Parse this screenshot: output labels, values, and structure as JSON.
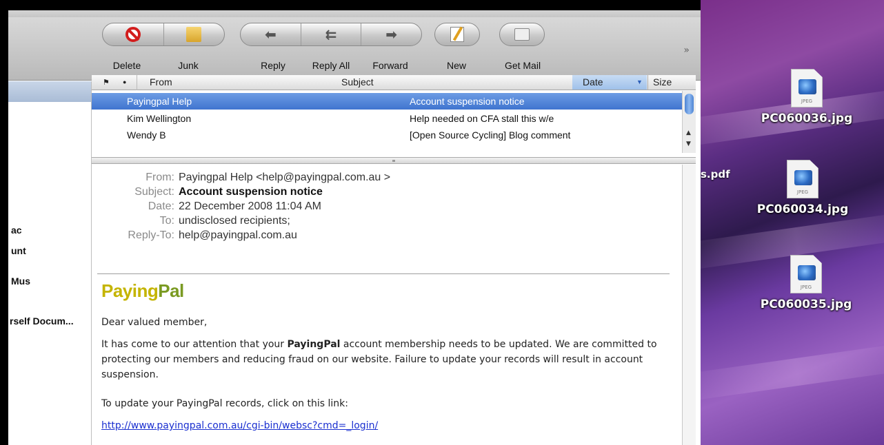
{
  "toolbar": {
    "delete": "Delete",
    "junk": "Junk",
    "reply": "Reply",
    "reply_all": "Reply All",
    "forward": "Forward",
    "new": "New",
    "get_mail": "Get Mail",
    "more": "»"
  },
  "sidebar": {
    "items": [
      "ac",
      "unt",
      "Mus",
      "rself Docum..."
    ]
  },
  "columns": {
    "flag": "⚑",
    "status": "●",
    "from": "From",
    "subject": "Subject",
    "date": "Date",
    "sort_arrow": "▼",
    "size": "Size"
  },
  "messages": [
    {
      "from": "Payingpal Help",
      "subject": "Account suspension notice"
    },
    {
      "from": "Kim Wellington",
      "subject": "Help needed on CFA stall this w/e"
    },
    {
      "from": "Wendy B",
      "subject": "[Open Source Cycling] Blog comment"
    }
  ],
  "email": {
    "labels": {
      "from": "From:",
      "subject": "Subject:",
      "date": "Date:",
      "to": "To:",
      "reply_to": "Reply-To:"
    },
    "from": "Payingpal Help <help@payingpal.com.au >",
    "subject": "Account suspension notice",
    "date": "22 December 2008  11:04 AM",
    "to": "undisclosed recipients;",
    "reply_to": "help@payingpal.com.au",
    "logo_part1": "Paying",
    "logo_part2": "Pal",
    "greeting": "Dear valued member,",
    "para1_before": "It has come to our attention that your ",
    "para1_bold": "PayingPal",
    "para1_after": " account membership needs to be updated.  We are committed to protecting our members and reducing fraud on our website.  Failure to update your records will result in account suspension.",
    "para2": "To update your PayingPal records, click on this link:",
    "link": "http://www.payingpal.com.au/cgi-bin/websc?cmd=_login/"
  },
  "desktop": {
    "partial_label": "s.pdf",
    "files": [
      {
        "name": "PC060036.jpg",
        "tag": "JPEG"
      },
      {
        "name": "PC060034.jpg",
        "tag": "JPEG"
      },
      {
        "name": "PC060035.jpg",
        "tag": "JPEG"
      }
    ]
  },
  "colors": {
    "selection": "#3f74cf",
    "logo_yellow": "#c4b400",
    "logo_green": "#7a9a22",
    "delete_red": "#d21d1d"
  }
}
